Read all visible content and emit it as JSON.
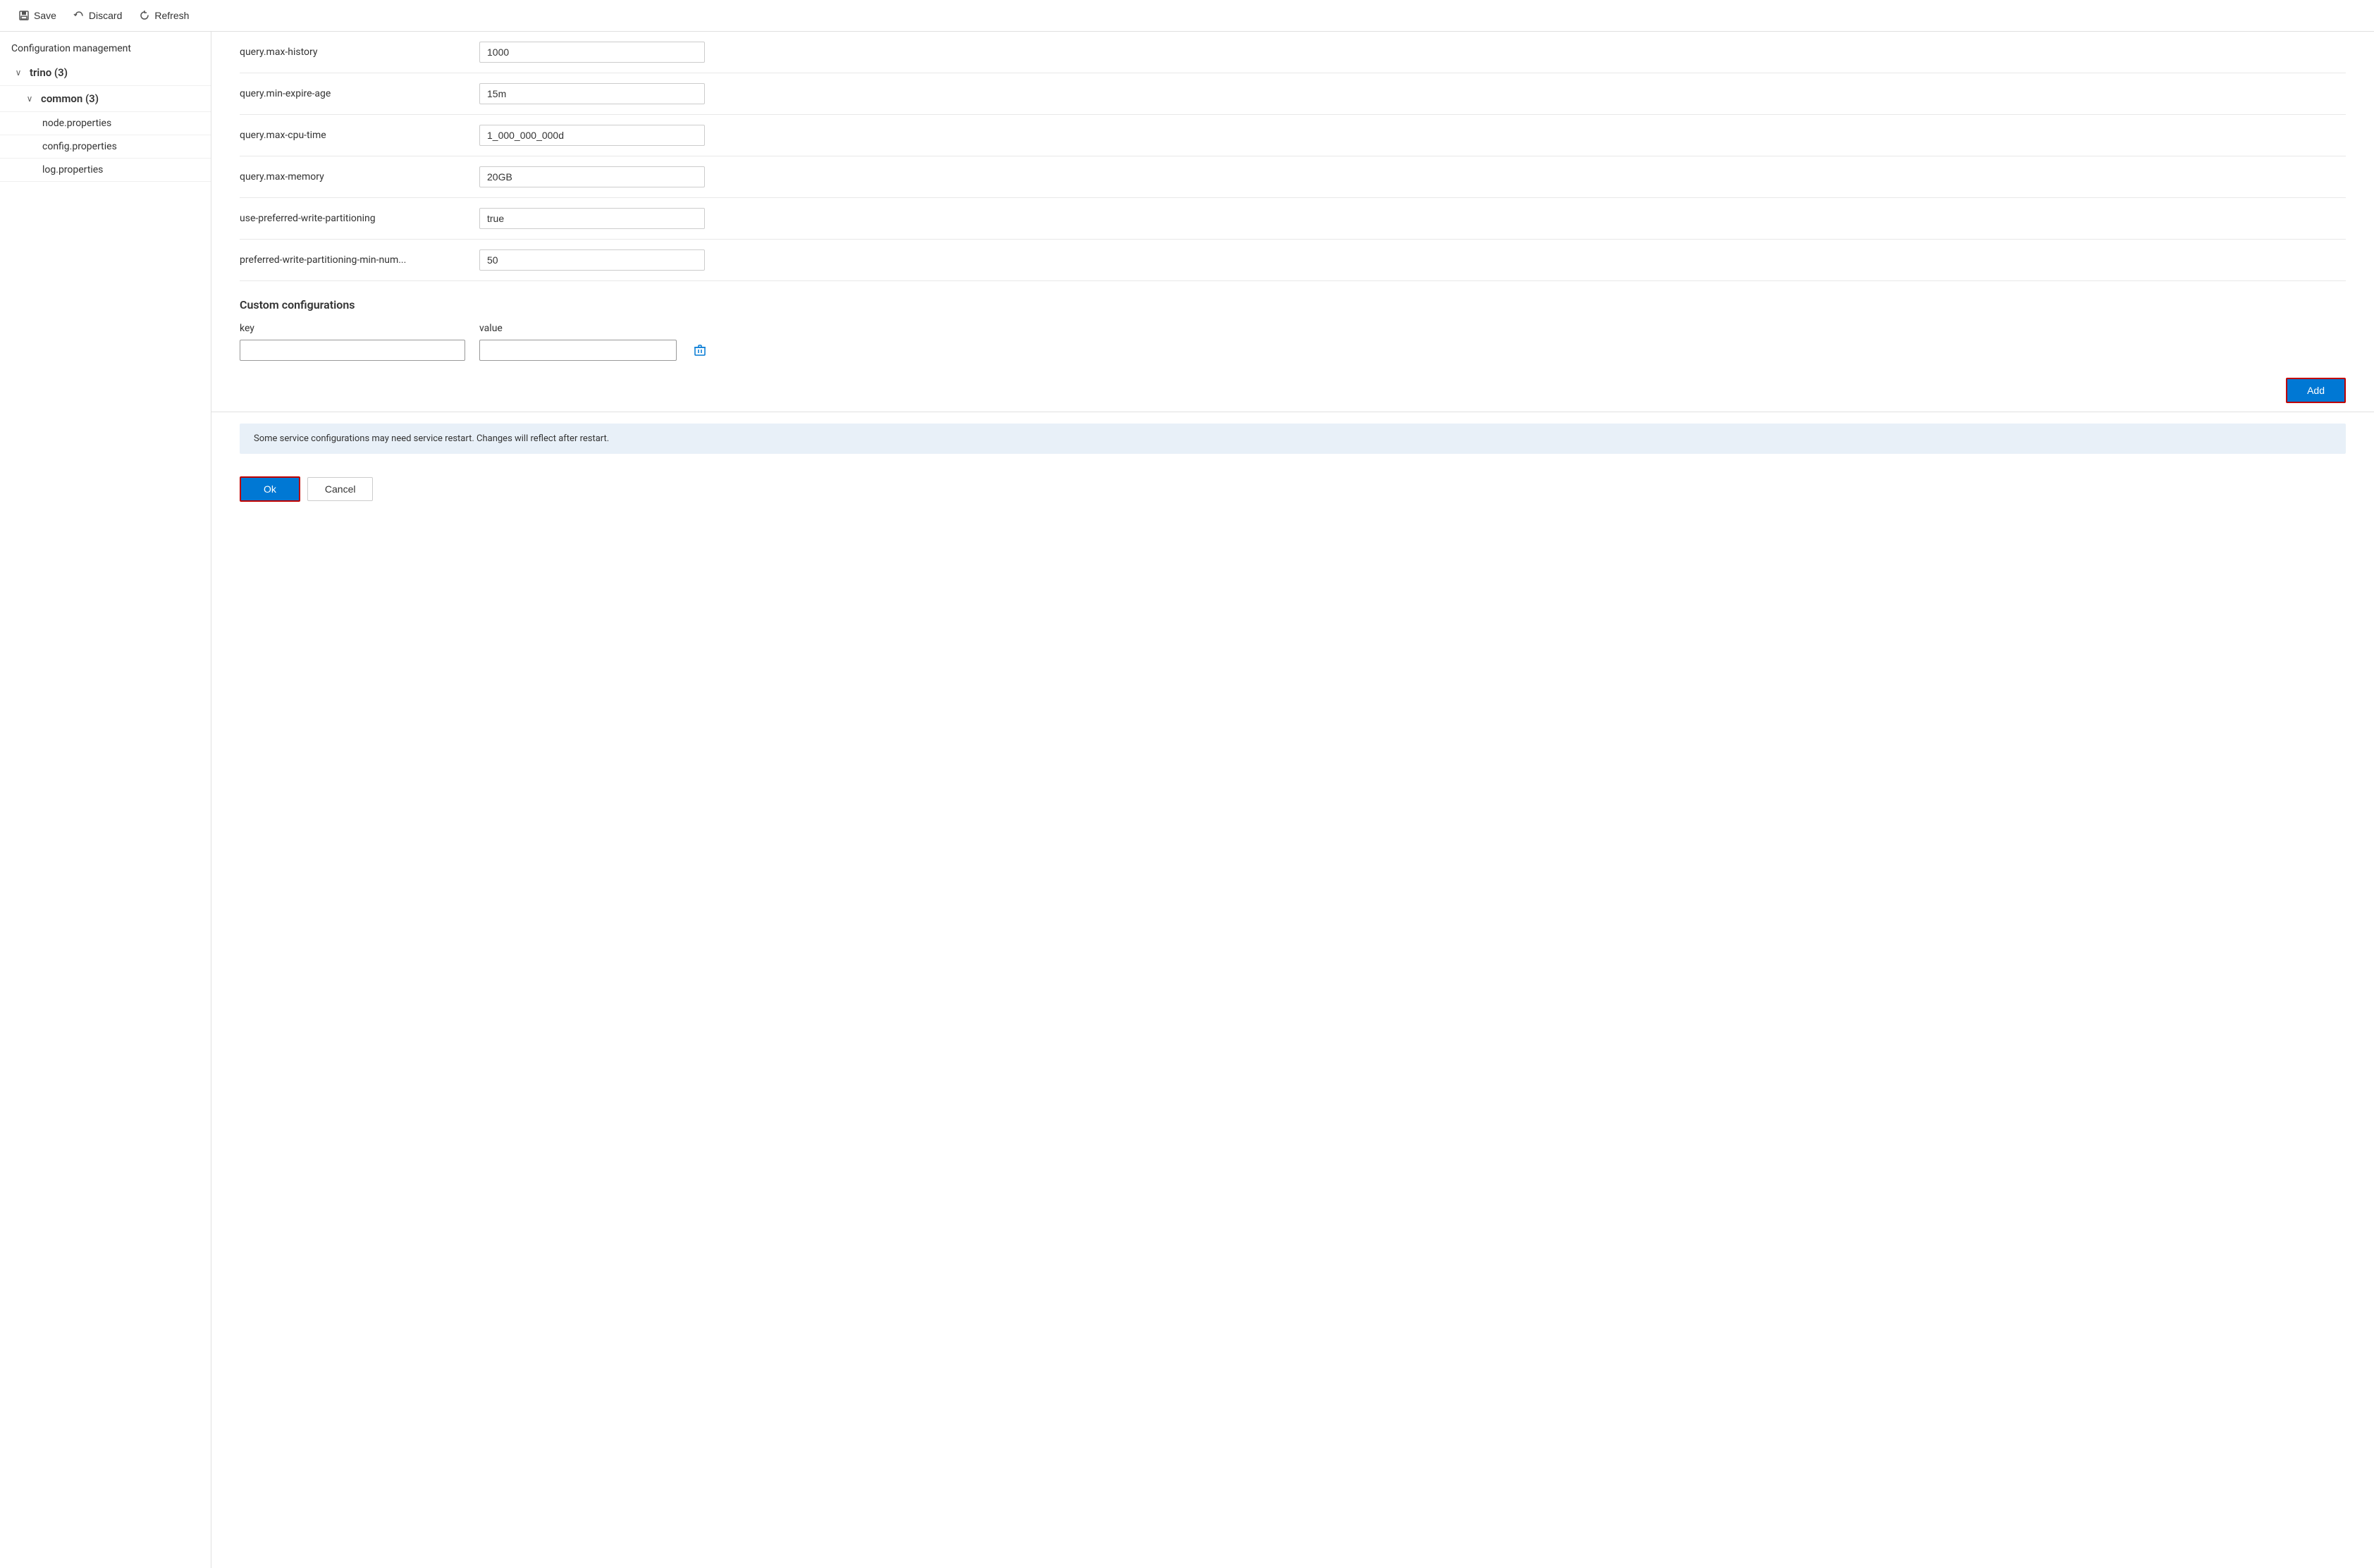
{
  "toolbar": {
    "save_label": "Save",
    "discard_label": "Discard",
    "refresh_label": "Refresh"
  },
  "sidebar": {
    "header": "Configuration management",
    "tree": [
      {
        "label": "trino (3)",
        "chevron": "∨",
        "expanded": true,
        "children": [
          {
            "label": "common (3)",
            "chevron": "∨",
            "expanded": true,
            "children": [
              {
                "label": "node.properties"
              },
              {
                "label": "config.properties"
              },
              {
                "label": "log.properties"
              }
            ]
          }
        ]
      }
    ]
  },
  "configs": [
    {
      "key": "query.max-history",
      "value": "1000"
    },
    {
      "key": "query.min-expire-age",
      "value": "15m"
    },
    {
      "key": "query.max-cpu-time",
      "value": "1_000_000_000d"
    },
    {
      "key": "query.max-memory",
      "value": "20GB"
    },
    {
      "key": "use-preferred-write-partitioning",
      "value": "true"
    },
    {
      "key": "preferred-write-partitioning-min-num...",
      "value": "50"
    }
  ],
  "custom_config": {
    "title": "Custom configurations",
    "key_header": "key",
    "value_header": "value",
    "key_placeholder": "",
    "value_placeholder": "",
    "add_label": "Add"
  },
  "info_banner": {
    "text": "Some service configurations may need service restart. Changes will reflect after restart."
  },
  "footer": {
    "ok_label": "Ok",
    "cancel_label": "Cancel"
  }
}
